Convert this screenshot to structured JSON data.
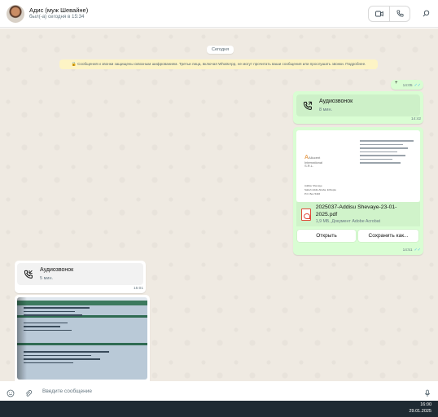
{
  "header": {
    "contact_name": "Адис (муж Шевайне)",
    "status": "был(-а) сегодня в 15:34",
    "video_icon": "video-camera-icon",
    "call_icon": "phone-icon",
    "search_icon": "search-icon"
  },
  "chat": {
    "date_chip": "Сегодня",
    "encryption_notice": "Сообщения и звонки защищены сквозным шифрованием. Третьи лица, включая WhatsApp, не могут прочитать ваши сообщения или прослушать звонки. Подробнее.",
    "msg1": {
      "text": "+",
      "time": "14:05"
    },
    "call_out": {
      "title": "Аудиозвонок",
      "duration": "8 мин.",
      "time": "14:42"
    },
    "document": {
      "file_name": "2025037-Addisu Shevaye-23-01-2025.pdf",
      "file_info": "1,9 МБ, Документ Adobe Acrobat",
      "open_label": "Открыть",
      "save_label": "Сохранить как...",
      "time": "14:51",
      "preview": {
        "logo_text": "Allucent International S.R.L.",
        "lines": [
          "Addisu Shevaye",
          "Sabeh Addis Ababa, Ethiopia",
          "P.O. Box 5446"
        ]
      }
    },
    "call_in": {
      "title": "Аудиозвонок",
      "duration": "5 мин.",
      "time": "15:01"
    }
  },
  "composer": {
    "placeholder": "Введите сообщение",
    "emoji_icon": "smiley-icon",
    "attach_icon": "paperclip-icon",
    "mic_icon": "microphone-icon"
  },
  "taskbar": {
    "time": "16:00",
    "date": "29.01.2025"
  },
  "colors": {
    "outgoing_bubble": "#d9fdd3",
    "chat_bg": "#efeae2",
    "read_tick": "#53bdeb"
  }
}
